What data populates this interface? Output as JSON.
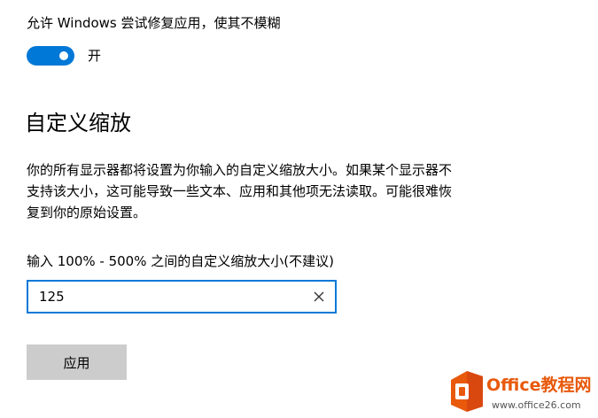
{
  "fix_apps": {
    "label": "允许 Windows 尝试修复应用，使其不模糊",
    "toggle_state": "开",
    "toggle_on": true
  },
  "custom_scaling": {
    "title": "自定义缩放",
    "description_lines": [
      "你的所有显示器都将设置为你输入的自定义缩放大小。如果某个显示器不",
      "支持该大小，这可能导致一些文本、应用和其他项无法读取。可能很难恢",
      "复到你的原始设置。"
    ],
    "input_label": "输入 100% - 500% 之间的自定义缩放大小(不建议)",
    "input_value": "125",
    "clear_icon": "close-icon",
    "apply_label": "应用"
  },
  "watermark": {
    "brand": "Office教程网",
    "url": "www.office26.com"
  },
  "colors": {
    "accent": "#0078d7",
    "button_bg": "#cccccc",
    "brand_orange": "#e8590c"
  }
}
